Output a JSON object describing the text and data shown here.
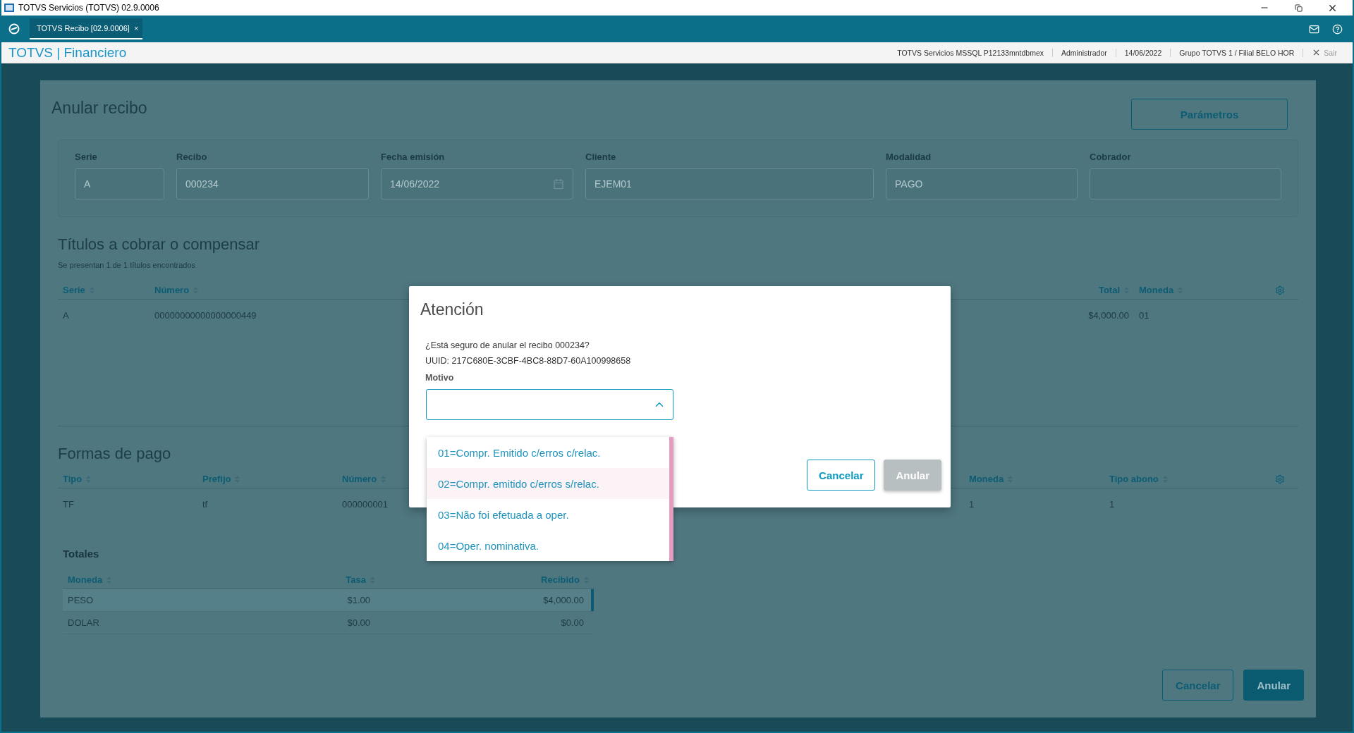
{
  "window": {
    "title": "TOTVS Servicios (TOTVS) 02.9.0006"
  },
  "tabs": [
    {
      "label": "TOTVS Recibo [02.9.0006]",
      "close": "×",
      "selected": true
    }
  ],
  "header": {
    "title": "TOTVS | Financiero",
    "info": [
      "TOTVS Servicios MSSQL P12133mntdbmex",
      "Administrador",
      "14/06/2022",
      "Grupo TOTVS 1 / Filial BELO HOR"
    ],
    "logout": "Sair"
  },
  "page": {
    "title": "Anular recibo",
    "parameters_button": "Parámetros",
    "fields": [
      {
        "label": "Serie",
        "value": "A",
        "kind": "text"
      },
      {
        "label": "Recibo",
        "value": "000234",
        "kind": "text"
      },
      {
        "label": "Fecha emisión",
        "value": "14/06/2022",
        "kind": "date"
      },
      {
        "label": "Cliente",
        "value": "EJEM01",
        "kind": "text"
      },
      {
        "label": "Modalidad",
        "value": "PAGO",
        "kind": "text"
      },
      {
        "label": "Cobrador",
        "kind": "text"
      }
    ]
  },
  "titles": {
    "title": "Títulos a cobrar o compensar",
    "subtitle": "Se presentan 1 de 1 títulos encontrados",
    "columns": [
      "Serie",
      "Número",
      "Total",
      "Moneda"
    ],
    "rows": [
      [
        "A",
        "00000000000000000449",
        "$4,000.00",
        "01"
      ]
    ]
  },
  "payments": {
    "title": "Formas de pago",
    "columns": [
      "Tipo",
      "Prefijo",
      "Número",
      "Moneda",
      "Tipo abono"
    ],
    "rows": [
      [
        "TF",
        "tf",
        "000000001",
        "1",
        "1"
      ]
    ]
  },
  "totals": {
    "title": "Totales",
    "columns": [
      "Moneda",
      "Tasa",
      "Recibido"
    ],
    "rows": [
      {
        "cells": [
          "PESO",
          "$1.00",
          "$4,000.00"
        ],
        "selected": true
      },
      {
        "cells": [
          "DOLAR",
          "$0.00",
          "$0.00"
        ],
        "selected": false
      }
    ]
  },
  "footer_buttons": [
    {
      "label": "Cancelar",
      "kind": "secondary"
    },
    {
      "label": "Anular",
      "kind": "primary"
    }
  ],
  "dialog": {
    "title": "Atención",
    "message": "¿Está seguro de anular el recibo 000234?",
    "uuid": "UUID: 217C680E-3CBF-4BC8-88D7-60A100998658",
    "field_label": "Motivo",
    "expanded": true,
    "options": [
      {
        "label": "01=Compr. Emitido c/erros c/relac.",
        "selected": false
      },
      {
        "label": "02=Compr. emitido c/erros s/relac.",
        "selected": true
      },
      {
        "label": "03=Não foi efetuada a oper.",
        "selected": false
      },
      {
        "label": "04=Oper. nominativa.",
        "selected": false
      }
    ],
    "buttons": [
      {
        "label": "Cancelar",
        "kind": "secondary",
        "disabled": false
      },
      {
        "label": "Anular",
        "kind": "primary",
        "disabled": true
      }
    ]
  }
}
